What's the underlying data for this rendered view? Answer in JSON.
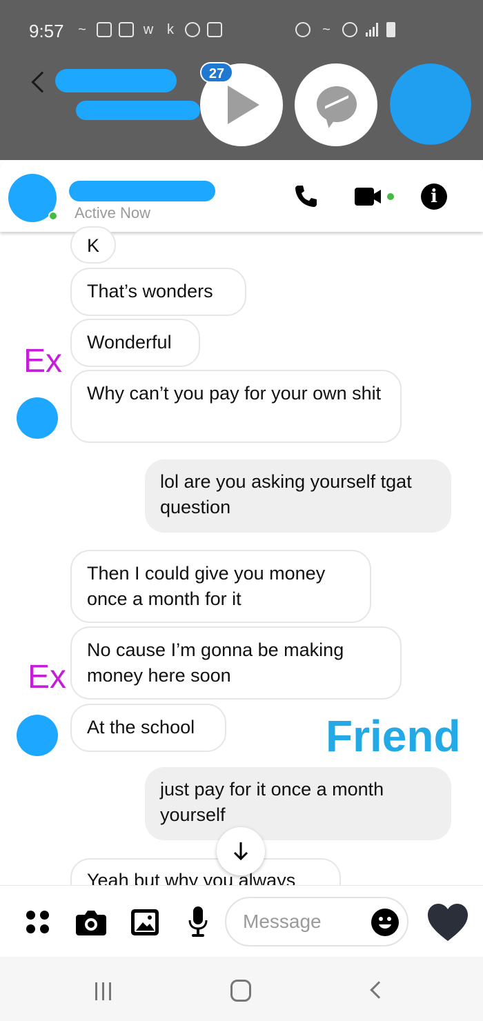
{
  "status_bar": {
    "time": "9:57"
  },
  "chat_heads": {
    "unread_badge": "27"
  },
  "header": {
    "status": "Active Now"
  },
  "messages": [
    {
      "side": "in",
      "text": "K"
    },
    {
      "side": "in",
      "text": "That’s wonders"
    },
    {
      "side": "in",
      "text": "Wonderful"
    },
    {
      "side": "in",
      "text": "Why can’t you pay for your own shit"
    },
    {
      "side": "out",
      "text": "lol are you asking yourself tgat question"
    },
    {
      "side": "in",
      "text": "Then I could give you money once a month for it"
    },
    {
      "side": "in",
      "text": "No cause I’m gonna be making money here soon"
    },
    {
      "side": "in",
      "text": "At the school"
    },
    {
      "side": "out",
      "text": "just pay for it once a month yourself"
    },
    {
      "side": "in",
      "text": "Yeah but why you always"
    }
  ],
  "annotations": {
    "ex_label_1": "Ex",
    "ex_label_2": "Ex",
    "friend_label": "Friend"
  },
  "composer": {
    "placeholder": "Message"
  },
  "colors": {
    "ex_label": "#c21fd6",
    "friend_label": "#22a9e6",
    "redaction": "#1ea7ff",
    "online": "#44bb44"
  },
  "icons": [
    "back-arrow-icon",
    "play-icon",
    "messenger-icon",
    "phone-icon",
    "video-icon",
    "info-icon",
    "scroll-down-icon",
    "apps-grid-icon",
    "camera-icon",
    "gallery-icon",
    "microphone-icon",
    "emoji-icon",
    "heart-icon",
    "recents-icon",
    "home-icon",
    "nav-back-icon"
  ]
}
